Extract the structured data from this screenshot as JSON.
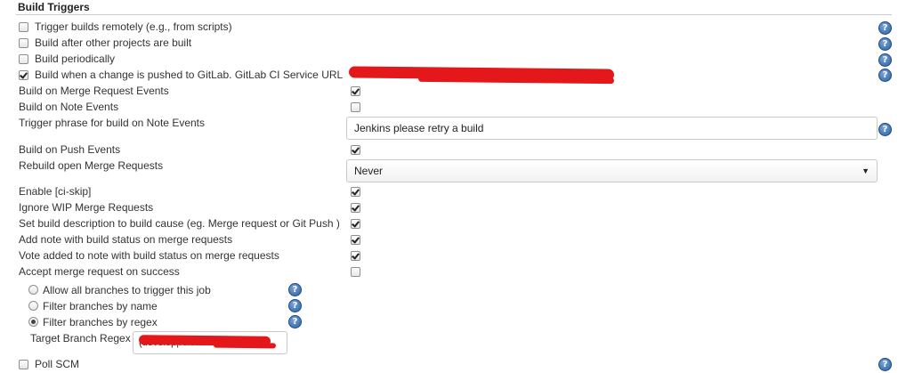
{
  "section": {
    "title": "Build Triggers"
  },
  "triggers": [
    {
      "label": "Trigger builds remotely (e.g., from scripts)",
      "checked": false
    },
    {
      "label": "Build after other projects are built",
      "checked": false
    },
    {
      "label": "Build periodically",
      "checked": false
    },
    {
      "label": "Build when a change is pushed to GitLab. GitLab CI Service URL",
      "checked": true
    }
  ],
  "gitlab": {
    "merge_request_events": {
      "label": "Build on Merge Request Events",
      "checked": true
    },
    "note_events": {
      "label": "Build on Note Events",
      "checked": false
    },
    "trigger_phrase": {
      "label": "Trigger phrase for build on Note Events",
      "value": "Jenkins please retry a build"
    },
    "push_events": {
      "label": "Build on Push Events",
      "checked": true
    },
    "rebuild_open": {
      "label": "Rebuild open Merge Requests",
      "value": "Never"
    },
    "ci_skip": {
      "label": "Enable [ci-skip]",
      "checked": true
    },
    "ignore_wip": {
      "label": "Ignore WIP Merge Requests",
      "checked": true
    },
    "set_description": {
      "label": "Set build description to build cause (eg. Merge request or Git Push )",
      "checked": true
    },
    "add_note": {
      "label": "Add note with build status on merge requests",
      "checked": true
    },
    "vote_note": {
      "label": "Vote added to note with build status on merge requests",
      "checked": true
    },
    "accept_mr": {
      "label": "Accept merge request on success",
      "checked": false
    }
  },
  "branch_filter": {
    "options": [
      {
        "label": "Allow all branches to trigger this job",
        "selected": false
      },
      {
        "label": "Filter branches by name",
        "selected": false
      },
      {
        "label": "Filter branches by regex",
        "selected": true
      }
    ],
    "regex_label": "Target Branch Regex",
    "regex_value": "(develop|release.*|hotfix)"
  },
  "poll_scm": {
    "label": "Poll SCM",
    "checked": false
  },
  "help_icon_glyph": "?",
  "colors": {
    "redaction": "#e4171b",
    "help": "#2b5f9e"
  }
}
